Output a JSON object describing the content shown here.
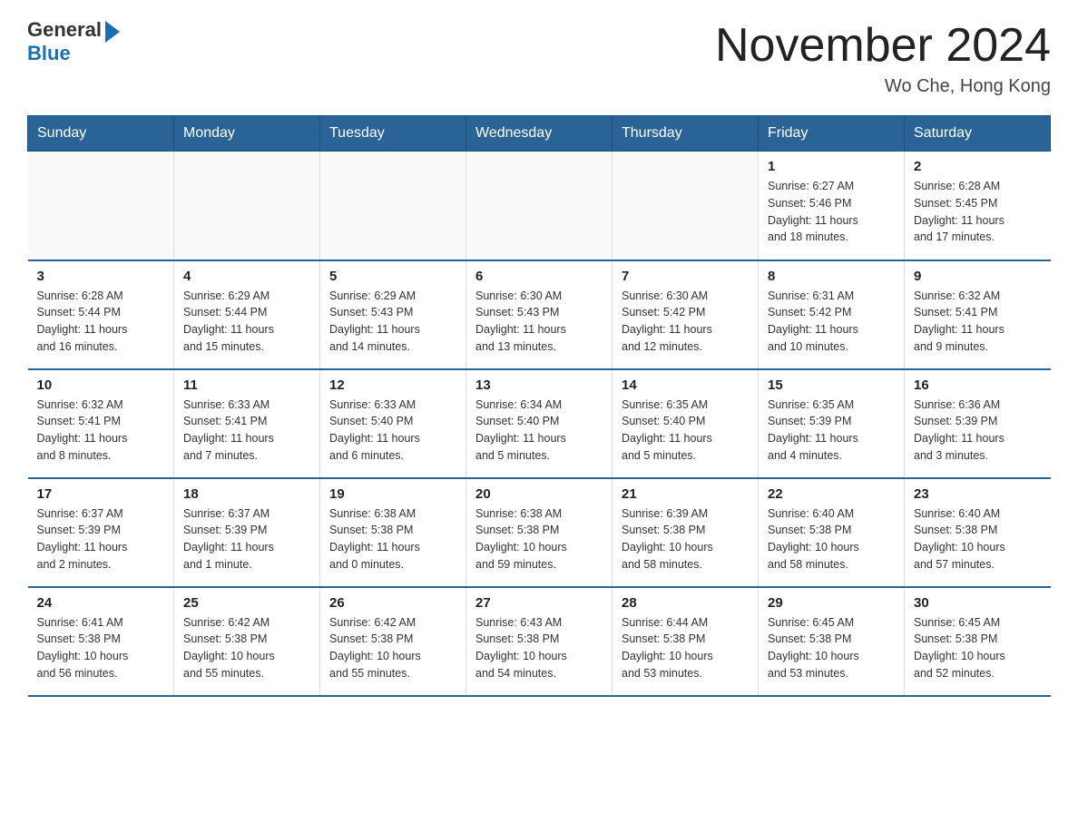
{
  "header": {
    "logo_general": "General",
    "logo_blue": "Blue",
    "month_title": "November 2024",
    "location": "Wo Che, Hong Kong"
  },
  "weekdays": [
    "Sunday",
    "Monday",
    "Tuesday",
    "Wednesday",
    "Thursday",
    "Friday",
    "Saturday"
  ],
  "weeks": [
    [
      {
        "day": "",
        "info": ""
      },
      {
        "day": "",
        "info": ""
      },
      {
        "day": "",
        "info": ""
      },
      {
        "day": "",
        "info": ""
      },
      {
        "day": "",
        "info": ""
      },
      {
        "day": "1",
        "info": "Sunrise: 6:27 AM\nSunset: 5:46 PM\nDaylight: 11 hours\nand 18 minutes."
      },
      {
        "day": "2",
        "info": "Sunrise: 6:28 AM\nSunset: 5:45 PM\nDaylight: 11 hours\nand 17 minutes."
      }
    ],
    [
      {
        "day": "3",
        "info": "Sunrise: 6:28 AM\nSunset: 5:44 PM\nDaylight: 11 hours\nand 16 minutes."
      },
      {
        "day": "4",
        "info": "Sunrise: 6:29 AM\nSunset: 5:44 PM\nDaylight: 11 hours\nand 15 minutes."
      },
      {
        "day": "5",
        "info": "Sunrise: 6:29 AM\nSunset: 5:43 PM\nDaylight: 11 hours\nand 14 minutes."
      },
      {
        "day": "6",
        "info": "Sunrise: 6:30 AM\nSunset: 5:43 PM\nDaylight: 11 hours\nand 13 minutes."
      },
      {
        "day": "7",
        "info": "Sunrise: 6:30 AM\nSunset: 5:42 PM\nDaylight: 11 hours\nand 12 minutes."
      },
      {
        "day": "8",
        "info": "Sunrise: 6:31 AM\nSunset: 5:42 PM\nDaylight: 11 hours\nand 10 minutes."
      },
      {
        "day": "9",
        "info": "Sunrise: 6:32 AM\nSunset: 5:41 PM\nDaylight: 11 hours\nand 9 minutes."
      }
    ],
    [
      {
        "day": "10",
        "info": "Sunrise: 6:32 AM\nSunset: 5:41 PM\nDaylight: 11 hours\nand 8 minutes."
      },
      {
        "day": "11",
        "info": "Sunrise: 6:33 AM\nSunset: 5:41 PM\nDaylight: 11 hours\nand 7 minutes."
      },
      {
        "day": "12",
        "info": "Sunrise: 6:33 AM\nSunset: 5:40 PM\nDaylight: 11 hours\nand 6 minutes."
      },
      {
        "day": "13",
        "info": "Sunrise: 6:34 AM\nSunset: 5:40 PM\nDaylight: 11 hours\nand 5 minutes."
      },
      {
        "day": "14",
        "info": "Sunrise: 6:35 AM\nSunset: 5:40 PM\nDaylight: 11 hours\nand 5 minutes."
      },
      {
        "day": "15",
        "info": "Sunrise: 6:35 AM\nSunset: 5:39 PM\nDaylight: 11 hours\nand 4 minutes."
      },
      {
        "day": "16",
        "info": "Sunrise: 6:36 AM\nSunset: 5:39 PM\nDaylight: 11 hours\nand 3 minutes."
      }
    ],
    [
      {
        "day": "17",
        "info": "Sunrise: 6:37 AM\nSunset: 5:39 PM\nDaylight: 11 hours\nand 2 minutes."
      },
      {
        "day": "18",
        "info": "Sunrise: 6:37 AM\nSunset: 5:39 PM\nDaylight: 11 hours\nand 1 minute."
      },
      {
        "day": "19",
        "info": "Sunrise: 6:38 AM\nSunset: 5:38 PM\nDaylight: 11 hours\nand 0 minutes."
      },
      {
        "day": "20",
        "info": "Sunrise: 6:38 AM\nSunset: 5:38 PM\nDaylight: 10 hours\nand 59 minutes."
      },
      {
        "day": "21",
        "info": "Sunrise: 6:39 AM\nSunset: 5:38 PM\nDaylight: 10 hours\nand 58 minutes."
      },
      {
        "day": "22",
        "info": "Sunrise: 6:40 AM\nSunset: 5:38 PM\nDaylight: 10 hours\nand 58 minutes."
      },
      {
        "day": "23",
        "info": "Sunrise: 6:40 AM\nSunset: 5:38 PM\nDaylight: 10 hours\nand 57 minutes."
      }
    ],
    [
      {
        "day": "24",
        "info": "Sunrise: 6:41 AM\nSunset: 5:38 PM\nDaylight: 10 hours\nand 56 minutes."
      },
      {
        "day": "25",
        "info": "Sunrise: 6:42 AM\nSunset: 5:38 PM\nDaylight: 10 hours\nand 55 minutes."
      },
      {
        "day": "26",
        "info": "Sunrise: 6:42 AM\nSunset: 5:38 PM\nDaylight: 10 hours\nand 55 minutes."
      },
      {
        "day": "27",
        "info": "Sunrise: 6:43 AM\nSunset: 5:38 PM\nDaylight: 10 hours\nand 54 minutes."
      },
      {
        "day": "28",
        "info": "Sunrise: 6:44 AM\nSunset: 5:38 PM\nDaylight: 10 hours\nand 53 minutes."
      },
      {
        "day": "29",
        "info": "Sunrise: 6:45 AM\nSunset: 5:38 PM\nDaylight: 10 hours\nand 53 minutes."
      },
      {
        "day": "30",
        "info": "Sunrise: 6:45 AM\nSunset: 5:38 PM\nDaylight: 10 hours\nand 52 minutes."
      }
    ]
  ]
}
